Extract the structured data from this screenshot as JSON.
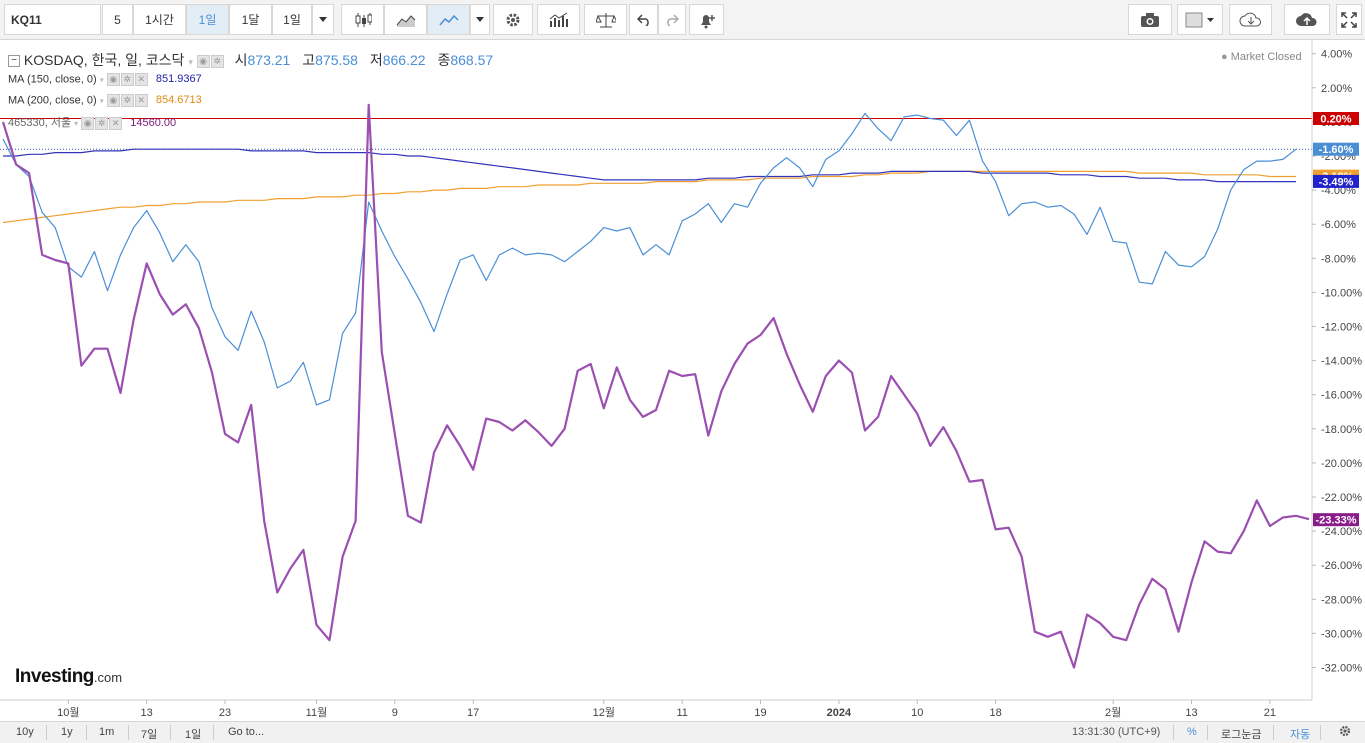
{
  "toolbar": {
    "symbol": "KQ11",
    "interval_5": "5",
    "interval_1h": "1시간",
    "interval_1d": "1일",
    "interval_1mo": "1달",
    "interval_1d_menu": "1일"
  },
  "legend": {
    "main_name": "KOSDAQ, 한국, 일, 코스닥",
    "open_label": "시",
    "open_value": "873.21",
    "high_label": "고",
    "high_value": "875.58",
    "low_label": "저",
    "low_value": "866.22",
    "close_label": "종",
    "close_value": "868.57",
    "ma150_label": "MA (150, close, 0)",
    "ma150_value": "851.9367",
    "ma200_label": "MA (200, close, 0)",
    "ma200_value": "854.6713",
    "cmp_label": "465330, 서울",
    "cmp_value": "14560.00",
    "market_status": "Market Closed"
  },
  "watermark": {
    "brand": "Investing",
    "suffix": ".com"
  },
  "bottom": {
    "periods": [
      "10y",
      "1y",
      "1m",
      "7일",
      "1일"
    ],
    "goto": "Go to...",
    "time": "13:31:30 (UTC+9)",
    "percent": "%",
    "log": "로그눈금",
    "auto": "자동"
  },
  "colors": {
    "kosdaq": "#4a8fd6",
    "ma150": "#3333bb",
    "ma200": "#f0a030",
    "compare": "#9b4fb0",
    "zero_line": "#cc0000"
  },
  "chart_data": {
    "type": "line",
    "y_unit": "%",
    "ylim": [
      -33.5,
      4.5
    ],
    "y_ticks": [
      "4.00%",
      "2.00%",
      "0.00%",
      "-2.00%",
      "-4.00%",
      "-6.00%",
      "-8.00%",
      "-10.00%",
      "-12.00%",
      "-14.00%",
      "-16.00%",
      "-18.00%",
      "-20.00%",
      "-22.00%",
      "-24.00%",
      "-26.00%",
      "-28.00%",
      "-30.00%",
      "-32.00%"
    ],
    "x_ticks": [
      "10월",
      "13",
      "23",
      "11월",
      "9",
      "17",
      "12월",
      "11",
      "19",
      "2024",
      "10",
      "18",
      "2월",
      "13",
      "21"
    ],
    "x_tick_index": [
      5,
      11,
      17,
      24,
      30,
      36,
      46,
      52,
      58,
      64,
      70,
      76,
      85,
      91,
      97
    ],
    "n_points": 100,
    "badges": [
      {
        "name": "zero",
        "text": "0.20%",
        "value": 0.2,
        "color": "#cc0000"
      },
      {
        "name": "kosdaq",
        "text": "-1.60%",
        "value": -1.6,
        "color": "#4a8fd6"
      },
      {
        "name": "ma200",
        "text": "-3.18%",
        "value": -3.18,
        "color": "#f0a030"
      },
      {
        "name": "ma150",
        "text": "-3.49%",
        "value": -3.49,
        "color": "#2222cc"
      },
      {
        "name": "compare",
        "text": "-23.33%",
        "value": -23.33,
        "color": "#8a1c8a"
      }
    ],
    "series": [
      {
        "name": "KOSDAQ",
        "color": "#4a8fd6",
        "values": [
          -1,
          -2.5,
          -3.2,
          -5.3,
          -6.2,
          -8.5,
          -9.1,
          -7.6,
          -9.9,
          -7.8,
          -6.2,
          -5.2,
          -6.5,
          -8.2,
          -7.2,
          -8.2,
          -10.9,
          -12.6,
          -13.4,
          -11.1,
          -12.9,
          -15.6,
          -15.2,
          -14.1,
          -16.6,
          -16.3,
          -12.4,
          -11.2,
          -4.7,
          -6.4,
          -7.9,
          -9.2,
          -10.6,
          -12.3,
          -10.1,
          -8.1,
          -7.8,
          -9.3,
          -7.8,
          -7.4,
          -7.8,
          -7.7,
          -7.8,
          -8.2,
          -7.6,
          -7.0,
          -6.2,
          -6.4,
          -6.2,
          -7.8,
          -7.2,
          -7.8,
          -5.8,
          -5.4,
          -4.8,
          -5.9,
          -4.8,
          -5.0,
          -3.6,
          -2.7,
          -2.1,
          -2.7,
          -3.8,
          -2.2,
          -1.7,
          -0.7,
          0.5,
          -0.4,
          -1.1,
          0.3,
          0.4,
          0.2,
          0.1,
          -0.8,
          0.1,
          -2.3,
          -3.5,
          -5.5,
          -4.8,
          -4.7,
          -5.0,
          -4.9,
          -5.4,
          -6.6,
          -5.0,
          -7.0,
          -7.1,
          -9.4,
          -9.5,
          -7.6,
          -8.4,
          -8.5,
          -7.9,
          -6.3,
          -4.0,
          -2.8,
          -2.3,
          -2.3,
          -2.2,
          -1.6
        ]
      },
      {
        "name": "MA (150, close, 0)",
        "color": "#3333bb",
        "values": [
          -2.0,
          -2.0,
          -1.9,
          -1.9,
          -1.8,
          -1.8,
          -1.8,
          -1.7,
          -1.7,
          -1.7,
          -1.6,
          -1.6,
          -1.6,
          -1.6,
          -1.6,
          -1.6,
          -1.6,
          -1.6,
          -1.6,
          -1.7,
          -1.7,
          -1.7,
          -1.7,
          -1.7,
          -1.8,
          -1.8,
          -1.8,
          -1.8,
          -1.8,
          -1.9,
          -1.9,
          -2.0,
          -2.0,
          -2.1,
          -2.2,
          -2.3,
          -2.4,
          -2.5,
          -2.6,
          -2.7,
          -2.8,
          -2.9,
          -3.0,
          -3.1,
          -3.2,
          -3.3,
          -3.4,
          -3.4,
          -3.4,
          -3.4,
          -3.4,
          -3.4,
          -3.4,
          -3.4,
          -3.3,
          -3.3,
          -3.3,
          -3.2,
          -3.2,
          -3.2,
          -3.2,
          -3.2,
          -3.1,
          -3.1,
          -3.1,
          -3.0,
          -3.0,
          -3.0,
          -2.9,
          -2.9,
          -2.9,
          -2.9,
          -2.9,
          -2.9,
          -2.9,
          -3.0,
          -3.0,
          -3.0,
          -3.0,
          -3.0,
          -3.0,
          -3.1,
          -3.1,
          -3.1,
          -3.2,
          -3.2,
          -3.2,
          -3.3,
          -3.3,
          -3.3,
          -3.4,
          -3.4,
          -3.4,
          -3.5,
          -3.5,
          -3.5,
          -3.5,
          -3.5,
          -3.5,
          -3.5
        ]
      },
      {
        "name": "MA (200, close, 0)",
        "color": "#f0a030",
        "values": [
          -5.9,
          -5.8,
          -5.7,
          -5.6,
          -5.5,
          -5.4,
          -5.3,
          -5.2,
          -5.1,
          -5.0,
          -5.0,
          -4.9,
          -4.9,
          -4.8,
          -4.8,
          -4.7,
          -4.7,
          -4.7,
          -4.6,
          -4.6,
          -4.6,
          -4.5,
          -4.5,
          -4.5,
          -4.4,
          -4.4,
          -4.4,
          -4.3,
          -4.3,
          -4.2,
          -4.2,
          -4.1,
          -4.1,
          -4.0,
          -4.0,
          -3.9,
          -3.9,
          -3.9,
          -3.8,
          -3.8,
          -3.8,
          -3.7,
          -3.7,
          -3.7,
          -3.7,
          -3.6,
          -3.6,
          -3.6,
          -3.6,
          -3.6,
          -3.5,
          -3.5,
          -3.5,
          -3.5,
          -3.4,
          -3.4,
          -3.4,
          -3.4,
          -3.3,
          -3.3,
          -3.3,
          -3.3,
          -3.2,
          -3.2,
          -3.2,
          -3.2,
          -3.1,
          -3.1,
          -3.0,
          -3.0,
          -3.0,
          -2.9,
          -2.9,
          -2.9,
          -2.9,
          -2.9,
          -2.9,
          -2.9,
          -2.9,
          -2.9,
          -2.9,
          -2.9,
          -2.9,
          -2.9,
          -2.9,
          -2.9,
          -2.9,
          -3.0,
          -3.0,
          -3.0,
          -3.0,
          -3.0,
          -3.1,
          -3.1,
          -3.1,
          -3.1,
          -3.1,
          -3.2,
          -3.2,
          -3.2
        ]
      },
      {
        "name": "465330, 서울",
        "color": "#9b4fb0",
        "values": [
          0,
          -2.5,
          -3.0,
          -7.8,
          -8.1,
          -8.3,
          -14.3,
          -13.3,
          -13.3,
          -15.9,
          -11.6,
          -8.3,
          -10.1,
          -11.3,
          -10.7,
          -12.1,
          -14.7,
          -18.3,
          -18.8,
          -16.6,
          -23.4,
          -27.6,
          -26.2,
          -25.1,
          -29.5,
          -30.4,
          -25.5,
          -23.4,
          1.0,
          -13.5,
          -18.3,
          -23.1,
          -23.5,
          -19.4,
          -17.8,
          -19.0,
          -20.4,
          -17.4,
          -17.6,
          -18.1,
          -17.5,
          -18.2,
          -19.0,
          -18.0,
          -14.6,
          -14.2,
          -16.8,
          -14.4,
          -16.3,
          -17.3,
          -16.9,
          -14.6,
          -14.9,
          -14.8,
          -18.4,
          -15.8,
          -14.2,
          -13.0,
          -12.5,
          -11.5,
          -13.6,
          -15.4,
          -17.0,
          -14.9,
          -14.0,
          -14.7,
          -18.1,
          -17.3,
          -14.9,
          -16.0,
          -17.1,
          -19.0,
          -17.9,
          -19.3,
          -21.1,
          -21.0,
          -23.9,
          -23.8,
          -25.5,
          -29.9,
          -30.2,
          -29.9,
          -32.0,
          -28.9,
          -29.4,
          -30.2,
          -30.4,
          -28.3,
          -26.8,
          -27.4,
          -29.9,
          -27.0,
          -24.6,
          -25.2,
          -25.3,
          -24.0,
          -22.2,
          -23.7,
          -23.2,
          -23.1,
          -23.3
        ]
      }
    ]
  }
}
